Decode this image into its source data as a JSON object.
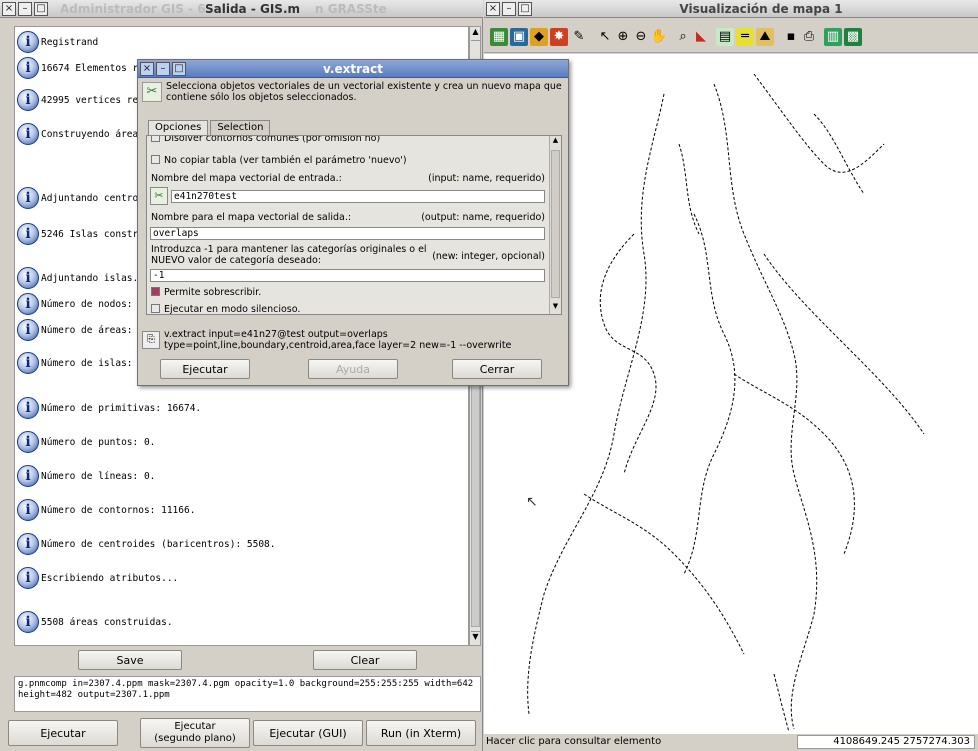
{
  "left_window": {
    "title": "Salida - GIS.m",
    "title_ghost": "Administrador GIS - 6.",
    "title_ghost_right": "n GRASSte",
    "messages": [
      {
        "text": "Registrand"
      },
      {
        "text": "16674 Elementos r"
      },
      {
        "text": "42995 vertices re"
      },
      {
        "text": "Construyendo área"
      },
      {
        "text": "Adjuntando centro"
      },
      {
        "text": "5246 Islas constr"
      },
      {
        "text": "Adjuntando islas."
      },
      {
        "text": "Número de nodos:"
      },
      {
        "text": "Número de áreas:"
      },
      {
        "text": "Número de islas:"
      },
      {
        "text": "Número de primitivas: 16674."
      },
      {
        "text": "Número de puntos: 0."
      },
      {
        "text": "Número de líneas: 0."
      },
      {
        "text": "Número de contornos: 11166."
      },
      {
        "text": "Número de centroides (baricentros): 5508."
      },
      {
        "text": "Escribiendo atributos..."
      },
      {
        "text": "5508 áreas construidas."
      }
    ],
    "save_label": "Save",
    "clear_label": "Clear",
    "command_text": "g.pnmcomp in=2307.4.ppm mask=2307.4.pgm opacity=1.0 background=255:255:255 width=642 height=482 output=2307.1.ppm",
    "buttons": {
      "run": "Ejecutar",
      "run_bg": "Ejecutar\n(segundo plano)",
      "run_gui": "Ejecutar (GUI)",
      "run_xterm": "Run (in Xterm)"
    }
  },
  "map_window": {
    "title": "Visualización de mapa 1",
    "status_text": "Hacer clic para consultar elemento",
    "coords": "4108649.245  2757274.303"
  },
  "dialog": {
    "title": "v.extract",
    "description": "Selecciona objetos vectoriales de un vectorial existente y crea un nuevo mapa que contiene sólo los objetos seleccionados.",
    "tabs": [
      "Opciones",
      "Selection"
    ],
    "opt_dissolve": "Disolver contornos comunes (por omisión no)",
    "opt_no_table": "No copiar tabla (ver también el parámetro 'nuevo')",
    "input_label": "Nombre del mapa vectorial de entrada.:",
    "input_note": "(input:  name, requerido)",
    "input_value": "e41n270test",
    "output_label": "Nombre para el mapa vectorial de salida.:",
    "output_note": "(output:  name, requerido)",
    "output_value": "overlaps",
    "new_label": "Introduzca -1 para mantener las categorías originales o el NUEVO valor de categoría deseado:",
    "new_note": "(new:  integer, opcional)",
    "new_value": "-1",
    "overwrite_label": "Permite sobrescribir.",
    "quiet_label": "Ejecutar en modo silencioso.",
    "command_preview": "v.extract input=e41n27@test output=overlaps type=point,line,boundary,centroid,area,face layer=2 new=-1 --overwrite",
    "run_label": "Ejecutar",
    "help_label": "Ayuda",
    "close_label": "Cerrar"
  }
}
